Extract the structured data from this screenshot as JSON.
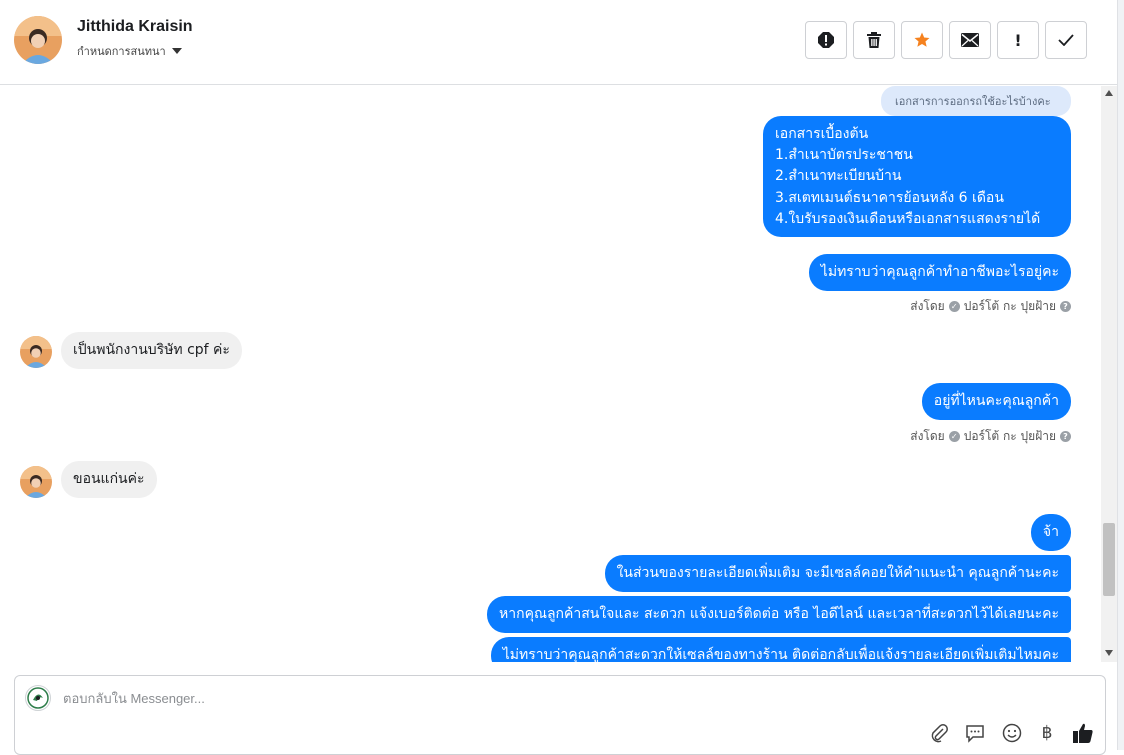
{
  "header": {
    "name": "Jitthida Kraisin",
    "subtitle": "กำหนดการสนทนา",
    "tools": [
      {
        "name": "spam-alert-icon"
      },
      {
        "name": "trash-icon"
      },
      {
        "name": "star-icon",
        "color": "#f5821f"
      },
      {
        "name": "mail-icon"
      },
      {
        "name": "exclamation-icon",
        "label": "!"
      },
      {
        "name": "check-icon"
      }
    ]
  },
  "messages": {
    "quoted_reply": "เอกสารการออกรถใช้อะไรบ้างคะ",
    "out_docs": {
      "line1": "เอกสารเบื้องต้น",
      "line2": "1.สำเนาบัตรประชาชน",
      "line3": "2.สำเนาทะเบียนบ้าน",
      "line4": "3.สเตทเมนต์ธนาคารย้อนหลัง 6 เดือน",
      "line5": "4.ใบรับรองเงินเดือนหรือเอกสารแสดงรายได้"
    },
    "out_occupation": "ไม่ทราบว่าคุณลูกค้าทำอาชีพอะไรอยู่คะ",
    "sent_by_1": {
      "prefix": "ส่งโดย",
      "agent": "ปอร์โต้ กะ ปุยฝ้าย"
    },
    "in_company": "เป็นพนักงานบริษัท cpf ค่ะ",
    "out_where": "อยู่ที่ไหนคะคุณลูกค้า",
    "sent_by_2": {
      "prefix": "ส่งโดย",
      "agent": "ปอร์โต้ กะ ปุยฝ้าย"
    },
    "in_location": "ขอนแก่นค่ะ",
    "out_ja": "จ้า",
    "out_detail": "ในส่วนของรายละเอียดเพิ่มเติม จะมีเซลล์คอยให้คำแนะนำ คุณลูกค้านะคะ",
    "out_contact": "หากคุณลูกค้าสนใจและ สะดวก แจ้งเบอร์ติดต่อ หรือ ไอดีไลน์ และเวลาที่สะดวกไว้ได้เลยนะคะ",
    "out_callback": "ไม่ทราบว่าคุณลูกค้าสะดวกให้เซลล์ของทางร้าน ติดต่อกลับเพื่อแจ้งรายละเอียดเพิ่มเติมไหมคะ"
  },
  "composer": {
    "placeholder": "ตอบกลับใน Messenger...",
    "icons": [
      "attachment-icon",
      "saved-reply-icon",
      "emoji-icon",
      "baht-payment-icon",
      "like-icon"
    ],
    "baht_symbol": "฿"
  },
  "colors": {
    "outgoing_bubble": "#0a7cff",
    "incoming_bubble": "#f0f0f0",
    "quoted_bubble": "#dde9fb"
  }
}
